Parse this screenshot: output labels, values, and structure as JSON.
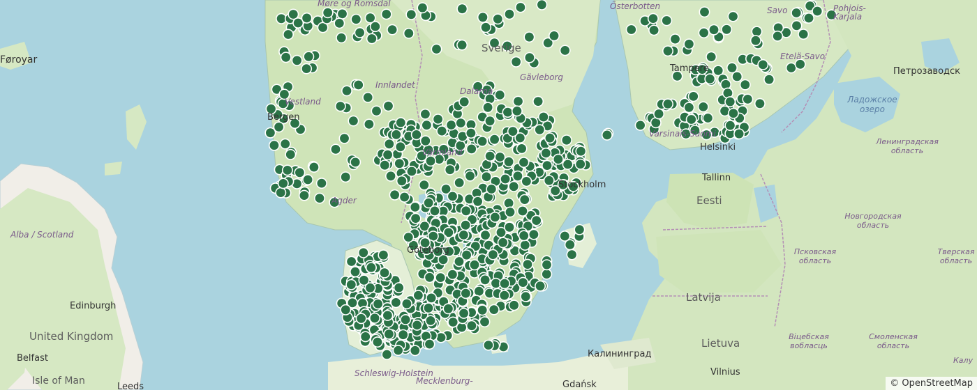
{
  "map": {
    "attribution": "© OpenStreetMap",
    "labels": {
      "sverige": "Sverige",
      "eesti": "Eesti",
      "latvija": "Latvija",
      "lietuva": "Lietuva",
      "united_kingdom": "United Kingdom",
      "alba": "Alba / Scotland",
      "edinburgh": "Edinburgh",
      "belfast": "Belfast",
      "isle_of_man": "Isle of Man",
      "leeds": "Leeds",
      "tallinn": "Tallinn",
      "helsinki": "Helsinki",
      "tampere": "Tampere",
      "vilnius": "Vilnius",
      "gdansk": "Gdańsk",
      "kaliningrad": "Калининград",
      "petrozavodsk": "Петрозаводск",
      "bergen": "Bergen",
      "stockholm": "Stockholm",
      "goteborg": "Göteborg",
      "faroe": "Føroyar",
      "vestland": "Vestland",
      "agder": "Agder",
      "more": "Møre og Romsdal",
      "innlandet": "Innlandet",
      "dalarna": "Dalarna",
      "varmland": "Värmland",
      "gavleborg": "Gävleborg",
      "osterbotten": "Österbotten",
      "savo": "Savo",
      "pohjois_karjala": "Pohjois-Karjala",
      "etela_savo": "Etelä-Savo",
      "varsinais_suomi": "Varsinais-Suomi",
      "schleswig": "Schleswig-Holstein",
      "mecklenburg": "Mecklenburg-",
      "ladoga": "Ладожское озеро",
      "leningrad": "Ленинградская область",
      "novgorod": "Новгородская область",
      "pskov": "Псковская область",
      "tver": "Тверская область",
      "vitebsk": "Віцебская вобласць",
      "smolensk": "Смоленская область",
      "kaluga": "Калу"
    },
    "marker_color": "#2b7347",
    "marker_count": 900
  }
}
